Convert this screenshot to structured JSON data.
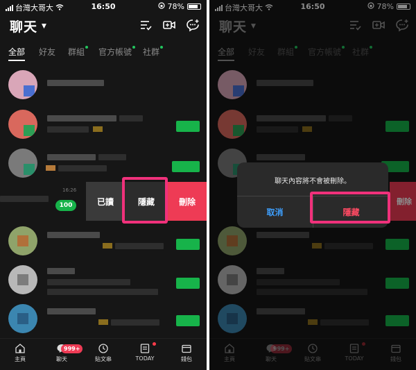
{
  "status": {
    "carrier": "台灣大哥大",
    "time": "16:50",
    "battery": "78%"
  },
  "header": {
    "title": "聊天"
  },
  "tabs": [
    {
      "label": "全部",
      "active": true
    },
    {
      "label": "好友",
      "active": false
    },
    {
      "label": "群組",
      "active": false
    },
    {
      "label": "官方帳號",
      "active": false
    },
    {
      "label": "社群",
      "active": false
    }
  ],
  "swipe": {
    "time": "16:26",
    "unread_count": "100",
    "actions": {
      "mark_read": "已讀",
      "hide": "隱藏",
      "delete": "刪除"
    }
  },
  "dialog": {
    "message": "聊天內容將不會被刪除。",
    "cancel_label": "取消",
    "hide_label": "隱藏",
    "peek_delete": "刪除"
  },
  "nav": {
    "items": [
      "主頁",
      "聊天",
      "貼文串",
      "TODAY",
      "錢包"
    ],
    "chat_badge": "999+"
  },
  "colors": {
    "background": "#161616",
    "accent_green": "#17b34a",
    "delete_red": "#ee3b55",
    "highlight_pink": "#f0317b",
    "dialog_blue": "#3ea0ff"
  }
}
